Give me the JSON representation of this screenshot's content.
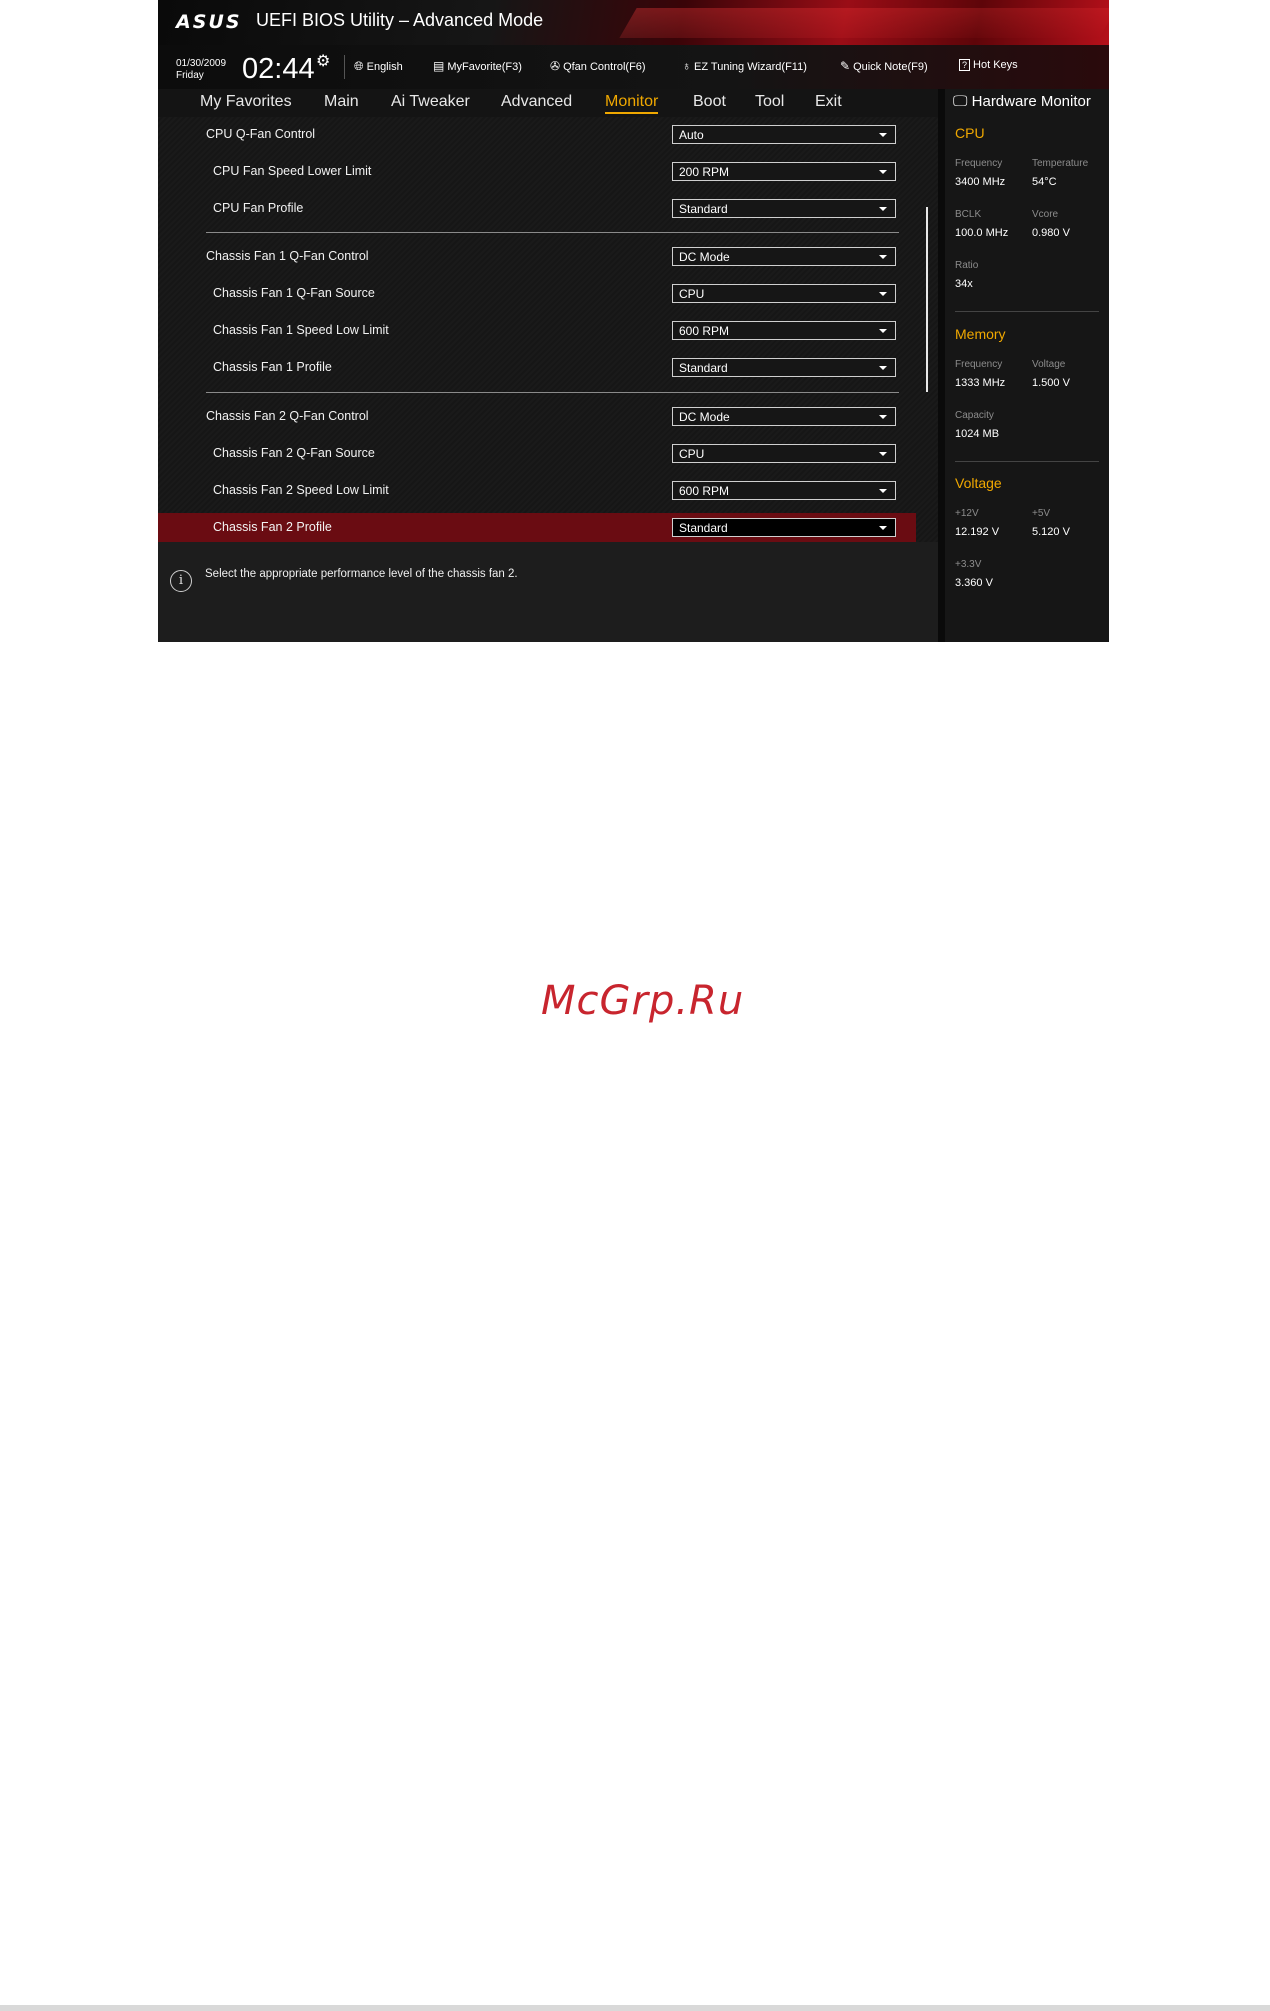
{
  "header": {
    "logo": "ASUS",
    "title": "UEFI BIOS Utility – Advanced Mode"
  },
  "toolbar": {
    "date": "01/30/2009",
    "day": "Friday",
    "time": "02:44",
    "items": [
      {
        "label": "English",
        "icon": "globe-icon"
      },
      {
        "label": "MyFavorite(F3)",
        "icon": "favorite-list-icon"
      },
      {
        "label": "Qfan Control(F6)",
        "icon": "fan-icon"
      },
      {
        "label": "EZ Tuning Wizard(F11)",
        "icon": "lightbulb-icon"
      },
      {
        "label": "Quick Note(F9)",
        "icon": "note-icon"
      },
      {
        "label": "Hot Keys",
        "icon": "question-icon"
      }
    ]
  },
  "nav": {
    "tabs": [
      "My Favorites",
      "Main",
      "Ai Tweaker",
      "Advanced",
      "Monitor",
      "Boot",
      "Tool",
      "Exit"
    ],
    "active": "Monitor"
  },
  "settings": [
    {
      "label": "CPU Q-Fan Control",
      "value": "Auto"
    },
    {
      "label": "CPU Fan Speed Lower Limit",
      "value": "200 RPM"
    },
    {
      "label": "CPU Fan Profile",
      "value": "Standard"
    },
    {
      "label": "Chassis Fan 1 Q-Fan Control",
      "value": "DC Mode"
    },
    {
      "label": "Chassis Fan 1 Q-Fan Source",
      "value": "CPU"
    },
    {
      "label": "Chassis Fan 1 Speed Low Limit",
      "value": "600 RPM"
    },
    {
      "label": "Chassis Fan 1 Profile",
      "value": "Standard"
    },
    {
      "label": "Chassis Fan 2 Q-Fan Control",
      "value": "DC Mode"
    },
    {
      "label": "Chassis Fan 2 Q-Fan Source",
      "value": "CPU"
    },
    {
      "label": "Chassis Fan 2 Speed Low Limit",
      "value": "600 RPM"
    },
    {
      "label": "Chassis Fan 2 Profile",
      "value": "Standard"
    }
  ],
  "info": {
    "text": "Select the appropriate performance level of the chassis fan 2."
  },
  "hardware_monitor": {
    "title": "Hardware Monitor",
    "cpu": {
      "heading": "CPU",
      "frequency_label": "Frequency",
      "frequency": "3400 MHz",
      "temperature_label": "Temperature",
      "temperature": "54°C",
      "bclk_label": "BCLK",
      "bclk": "100.0 MHz",
      "vcore_label": "Vcore",
      "vcore": "0.980 V",
      "ratio_label": "Ratio",
      "ratio": "34x"
    },
    "memory": {
      "heading": "Memory",
      "frequency_label": "Frequency",
      "frequency": "1333 MHz",
      "voltage_label": "Voltage",
      "voltage": "1.500 V",
      "capacity_label": "Capacity",
      "capacity": "1024 MB"
    },
    "voltage": {
      "heading": "Voltage",
      "v12_label": "+12V",
      "v12": "12.192 V",
      "v5_label": "+5V",
      "v5": "5.120 V",
      "v33_label": "+3.3V",
      "v33": "3.360 V"
    }
  },
  "watermark": "McGrp.Ru"
}
